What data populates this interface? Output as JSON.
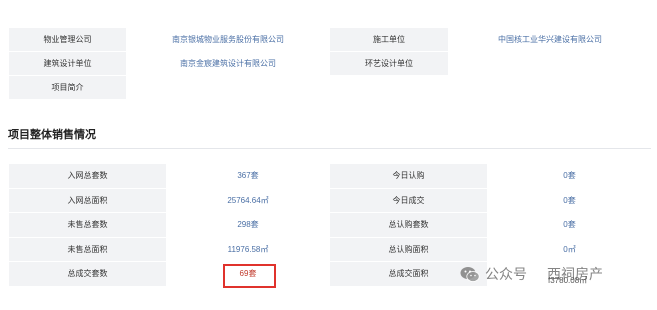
{
  "colors": {
    "label_bg": "#f2f3f5",
    "value_text": "#4a6fa5",
    "highlight_border": "#e0322c"
  },
  "info_table": {
    "row1": {
      "label_a": "物业管理公司",
      "value_a": "南京银城物业服务股份有限公司",
      "label_b": "施工单位",
      "value_b": "中国核工业华兴建设有限公司"
    },
    "row2": {
      "label_a": "建筑设计单位",
      "value_a": "南京金宸建筑设计有限公司",
      "label_b": "环艺设计单位",
      "value_b": ""
    },
    "row3": {
      "label_a": "项目简介",
      "value_a": ""
    }
  },
  "sales_section": {
    "title": "项目整体销售情况",
    "rows": [
      {
        "label_a": "入网总套数",
        "value_a": "367套",
        "label_b": "今日认购",
        "value_b": "0套"
      },
      {
        "label_a": "入网总面积",
        "value_a": "25764.64㎡",
        "label_b": "今日成交",
        "value_b": "0套"
      },
      {
        "label_a": "未售总套数",
        "value_a": "298套",
        "label_b": "总认购套数",
        "value_b": "0套"
      },
      {
        "label_a": "未售总面积",
        "value_a": "11976.58㎡",
        "label_b": "总认购面积",
        "value_b": "0㎡"
      },
      {
        "label_a": "总成交套数",
        "value_a": "69套",
        "label_b": "总成交面积",
        "value_b": ""
      }
    ]
  },
  "watermark": {
    "text_a": "公众号",
    "text_b": "西祠房产",
    "icon": "wechat-icon",
    "partial_id": "f3780.08㎡"
  }
}
